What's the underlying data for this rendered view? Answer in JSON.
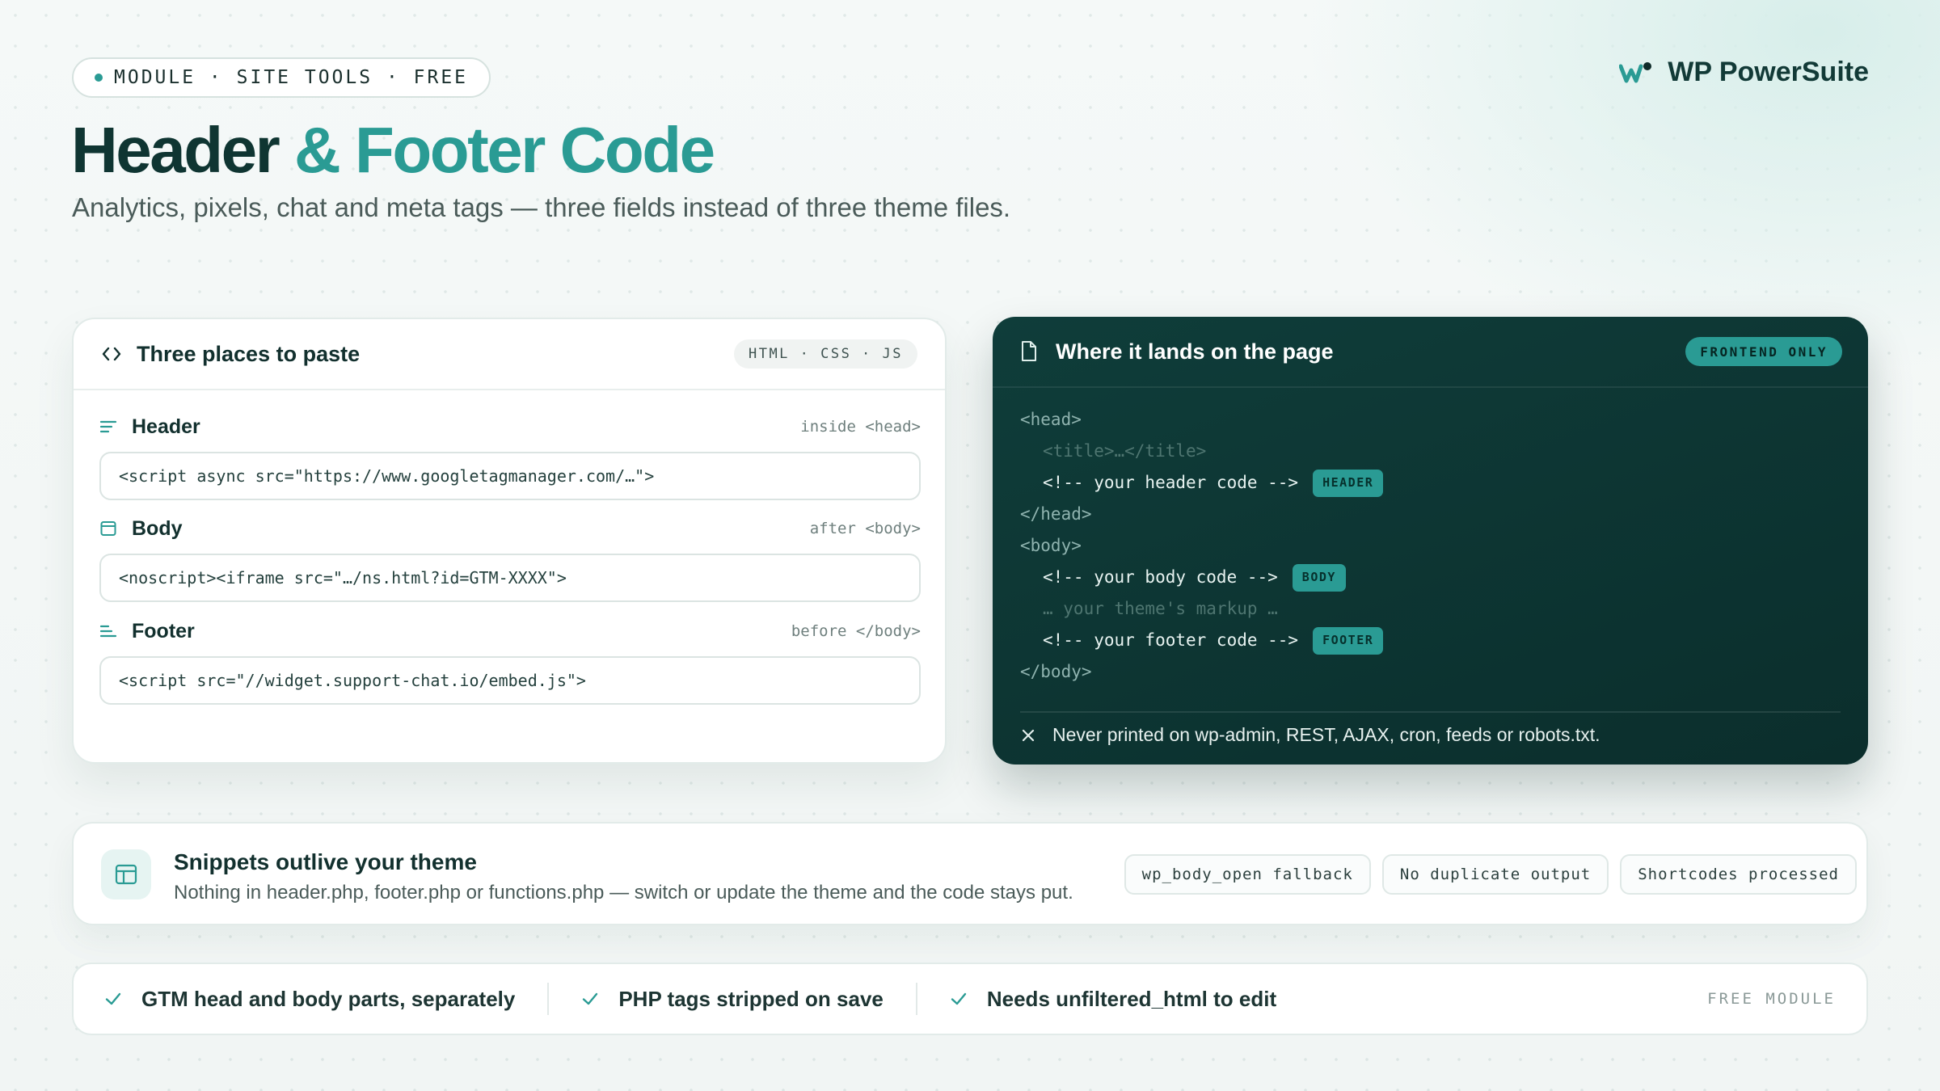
{
  "header": {
    "module_pill": "MODULE · SITE TOOLS · FREE",
    "brand": "WP PowerSuite",
    "title_main": "Header",
    "title_accent": "& Footer Code",
    "subtitle": "Analytics, pixels, chat and meta tags — three fields instead of three theme files."
  },
  "left_card": {
    "title": "Three places to paste",
    "lang_pill": "HTML · CSS · JS",
    "fields": [
      {
        "name": "Header",
        "hint": "inside <head>",
        "value": "<script async src=\"https://www.googletagmanager.com/…\">",
        "icon": "align-left-icon"
      },
      {
        "name": "Body",
        "hint": "after <body>",
        "value": "<noscript><iframe src=\"…/ns.html?id=GTM-XXXX\">",
        "icon": "window-icon"
      },
      {
        "name": "Footer",
        "hint": "before </body>",
        "value": "<script src=\"//widget.support-chat.io/embed.js\">",
        "icon": "align-bottom-icon"
      }
    ]
  },
  "right_card": {
    "title": "Where it lands on the page",
    "pill": "FRONTEND ONLY",
    "code": {
      "head_open": "<head>",
      "title_line": "<title>…</title>",
      "header_comment": "<!-- your header code -->",
      "header_badge": "HEADER",
      "head_close": "</head>",
      "body_open": "<body>",
      "body_comment": "<!-- your body code -->",
      "body_badge": "BODY",
      "markup_line": "… your theme's markup …",
      "footer_comment": "<!-- your footer code -->",
      "footer_badge": "FOOTER",
      "body_close": "</body>"
    },
    "note": "Never printed on wp-admin, REST, AJAX, cron, feeds or robots.txt."
  },
  "snippets": {
    "title": "Snippets outlive your theme",
    "desc": "Nothing in header.php, footer.php or functions.php — switch or update the theme and the code stays put.",
    "chips": [
      "wp_body_open fallback",
      "No duplicate output",
      "Shortcodes processed"
    ]
  },
  "bottom": {
    "features": [
      "GTM head and body parts, separately",
      "PHP tags stripped on save",
      "Needs unfiltered_html to edit"
    ],
    "label": "FREE MODULE"
  },
  "colors": {
    "accent": "#2a9b94",
    "dark": "#0f3d3a",
    "text": "#10302e"
  }
}
